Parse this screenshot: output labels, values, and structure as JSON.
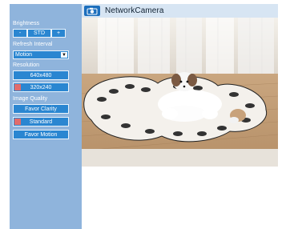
{
  "app": {
    "title": "NetworkCamera",
    "icon": "camera-icon"
  },
  "sidebar": {
    "brightness": {
      "label": "Brightness",
      "minus_label": "-",
      "value": "STD",
      "plus_label": "+"
    },
    "refresh_interval": {
      "label": "Refresh Interval",
      "selected": "Motion"
    },
    "resolution": {
      "label": "Resolution",
      "options": [
        "640x480",
        "320x240"
      ],
      "selected": "320x240"
    },
    "image_quality": {
      "label": "Image Quality",
      "options": [
        "Favor Clarity",
        "Standard",
        "Favor Motion"
      ],
      "selected": "Standard"
    }
  },
  "viewer": {
    "scene": "camera-feed-image"
  },
  "colors": {
    "sidebar": "#8fb4dc",
    "button": "#2a86d1",
    "marker": "#e06c6c"
  }
}
